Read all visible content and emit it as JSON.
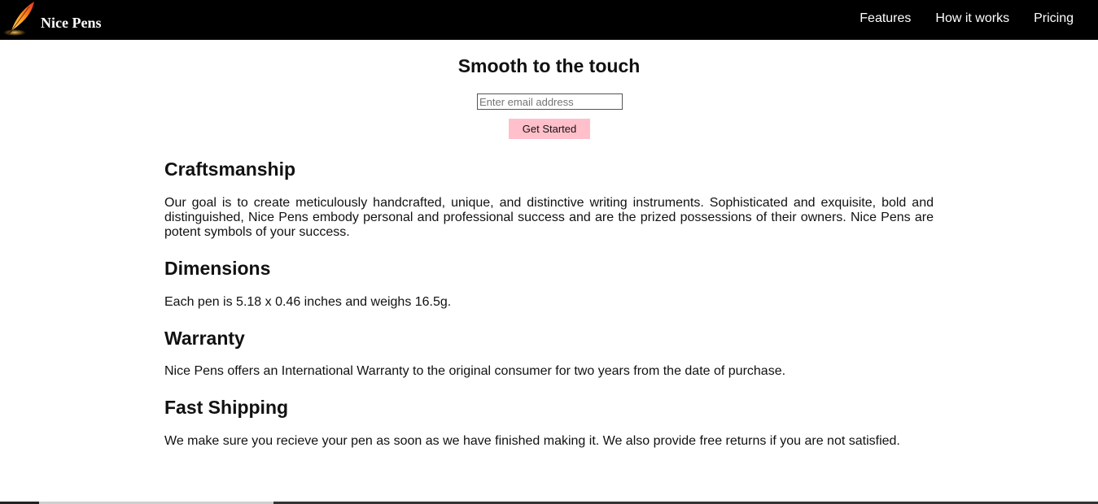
{
  "header": {
    "brand": "Nice Pens",
    "logo_icon": "quill-feather-icon",
    "nav": [
      {
        "label": "Features"
      },
      {
        "label": "How it works"
      },
      {
        "label": "Pricing"
      }
    ]
  },
  "hero": {
    "title": "Smooth to the touch",
    "email_placeholder": "Enter email address",
    "email_value": "",
    "cta_label": "Get Started"
  },
  "sections": [
    {
      "heading": "Craftsmanship",
      "body": "Our goal is to create meticulously handcrafted, unique, and distinctive writing instruments. Sophisticated and exquisite, bold and distinguished, Nice Pens embody personal and professional success and are the prized possessions of their owners. Nice Pens are potent symbols of your success."
    },
    {
      "heading": "Dimensions",
      "body": "Each pen is 5.18 x 0.46 inches and weighs 16.5g."
    },
    {
      "heading": "Warranty",
      "body": "Nice Pens offers an International Warranty to the original consumer for two years from the date of purchase."
    },
    {
      "heading": "Fast Shipping",
      "body": "We make sure you recieve your pen as soon as we have finished making it. We also provide free returns if you are not satisfied."
    }
  ],
  "colors": {
    "header_bg": "#000000",
    "cta_bg": "#ffc0cb"
  }
}
